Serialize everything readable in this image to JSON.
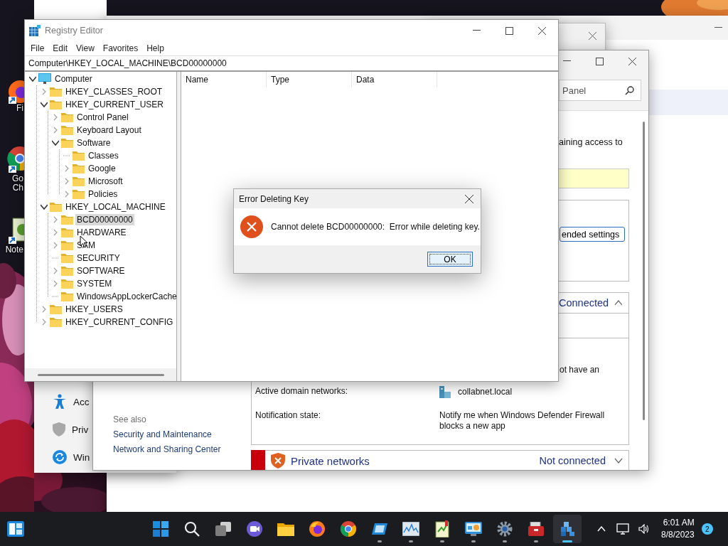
{
  "desktop_icons": [
    {
      "kind": "firefox",
      "label_lines": [
        "Fi"
      ]
    },
    {
      "kind": "chrome",
      "label_lines": [
        "Go",
        "Ch"
      ]
    },
    {
      "kind": "notepad",
      "label_lines": [
        "Note"
      ]
    }
  ],
  "settings_window": {
    "items": [
      {
        "kind": "accessibility",
        "label": "Acc"
      },
      {
        "kind": "privacy",
        "label": "Priv"
      },
      {
        "kind": "update",
        "label": "Win"
      }
    ]
  },
  "control_panel": {
    "search": {
      "placeholder": "Panel"
    },
    "intro_text": "aining access to",
    "settings_button": "ended settings",
    "domain_section": {
      "status": "Connected",
      "expanded": true,
      "note_lines": [
        "ot have an"
      ],
      "rows": [
        {
          "kind": "network",
          "label": "Active domain networks:",
          "value": "collabnet.local"
        },
        {
          "kind": "text",
          "label": "Notification state:",
          "value": "Notify me when Windows Defender Firewall blocks a new app"
        }
      ]
    },
    "private_section": {
      "title": "Private networks",
      "status": "Not connected",
      "expanded": false
    },
    "see_also": {
      "title": "See also",
      "links": [
        "Security and Maintenance",
        "Network and Sharing Center"
      ]
    }
  },
  "registry_editor": {
    "title": "Registry Editor",
    "menu": [
      "File",
      "Edit",
      "View",
      "Favorites",
      "Help"
    ],
    "address": "Computer\\HKEY_LOCAL_MACHINE\\BCD00000000",
    "tree": [
      {
        "label": "Computer",
        "kind": "computer",
        "expandable": true,
        "expanded": true,
        "selected": false,
        "children": [
          {
            "label": "HKEY_CLASSES_ROOT",
            "kind": "folder",
            "expandable": true,
            "expanded": false,
            "selected": false
          },
          {
            "label": "HKEY_CURRENT_USER",
            "kind": "folder",
            "expandable": true,
            "expanded": true,
            "selected": false,
            "children": [
              {
                "label": "Control Panel",
                "kind": "folder",
                "expandable": true,
                "expanded": false,
                "selected": false
              },
              {
                "label": "Keyboard Layout",
                "kind": "folder",
                "expandable": true,
                "expanded": false,
                "selected": false
              },
              {
                "label": "Software",
                "kind": "folder",
                "expandable": true,
                "expanded": true,
                "selected": false,
                "children": [
                  {
                    "label": "Classes",
                    "kind": "folder",
                    "expandable": false,
                    "selected": false
                  },
                  {
                    "label": "Google",
                    "kind": "folder",
                    "expandable": true,
                    "expanded": false,
                    "selected": false
                  },
                  {
                    "label": "Microsoft",
                    "kind": "folder",
                    "expandable": true,
                    "expanded": false,
                    "selected": false
                  },
                  {
                    "label": "Policies",
                    "kind": "folder",
                    "expandable": true,
                    "expanded": false,
                    "selected": false
                  }
                ]
              }
            ]
          },
          {
            "label": "HKEY_LOCAL_MACHINE",
            "kind": "folder",
            "expandable": true,
            "expanded": true,
            "selected": false,
            "children": [
              {
                "label": "BCD00000000",
                "kind": "folder",
                "expandable": true,
                "expanded": false,
                "selected": true
              },
              {
                "label": "HARDWARE",
                "kind": "folder",
                "expandable": true,
                "expanded": false,
                "selected": false
              },
              {
                "label": "SAM",
                "kind": "folder",
                "expandable": true,
                "expanded": false,
                "selected": false
              },
              {
                "label": "SECURITY",
                "kind": "folder",
                "expandable": false,
                "selected": false
              },
              {
                "label": "SOFTWARE",
                "kind": "folder",
                "expandable": true,
                "expanded": false,
                "selected": false
              },
              {
                "label": "SYSTEM",
                "kind": "folder",
                "expandable": true,
                "expanded": false,
                "selected": false
              },
              {
                "label": "WindowsAppLockerCache",
                "kind": "folder",
                "expandable": false,
                "selected": false
              }
            ]
          },
          {
            "label": "HKEY_USERS",
            "kind": "folder",
            "expandable": true,
            "expanded": false,
            "selected": false
          },
          {
            "label": "HKEY_CURRENT_CONFIG",
            "kind": "folder",
            "expandable": true,
            "expanded": false,
            "selected": false
          }
        ]
      }
    ],
    "columns": [
      "Name",
      "Type",
      "Data"
    ]
  },
  "dialog": {
    "title": "Error Deleting Key",
    "message": "Cannot delete BCD00000000:  Error while deleting key.",
    "button": "OK"
  },
  "taskbar": {
    "apps": [
      {
        "kind": "start",
        "running": false,
        "selected": false
      },
      {
        "kind": "search",
        "running": false,
        "selected": false
      },
      {
        "kind": "taskview",
        "running": false,
        "selected": false
      },
      {
        "kind": "chat",
        "running": false,
        "selected": false
      },
      {
        "kind": "explorer",
        "running": false,
        "selected": false
      },
      {
        "kind": "firefox",
        "running": false,
        "selected": false
      },
      {
        "kind": "chrome",
        "running": false,
        "selected": false
      },
      {
        "kind": "window",
        "running": true,
        "selected": false
      },
      {
        "kind": "chart",
        "running": true,
        "selected": false
      },
      {
        "kind": "notepad",
        "running": true,
        "selected": false
      },
      {
        "kind": "dashboard",
        "running": true,
        "selected": false
      },
      {
        "kind": "gear",
        "running": true,
        "selected": false
      },
      {
        "kind": "toolbox",
        "running": true,
        "selected": false
      },
      {
        "kind": "cubes",
        "running": true,
        "selected": true
      }
    ],
    "time": "6:01 AM",
    "date": "8/8/2023",
    "notification_count": "2"
  }
}
